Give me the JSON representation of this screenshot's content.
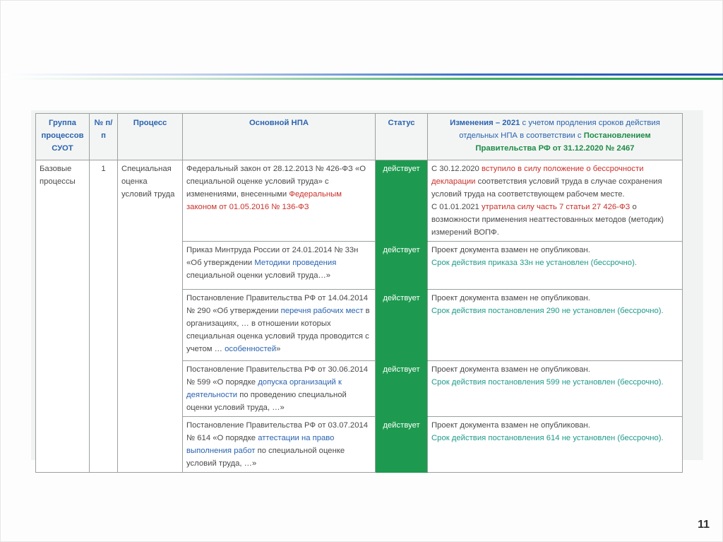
{
  "slide": {
    "page_number": "11"
  },
  "table": {
    "headers": {
      "group": "Группа процессов СУОТ",
      "num": "№ п/п",
      "process": "Процесс",
      "npa": "Основной НПА",
      "status": "Статус",
      "changes_part1": "Изменения – 2021",
      "changes_part2": " с учетом продления сроков действия отдельных НПА в соответствии с ",
      "changes_part3": "Постановлением Правительства РФ от 31.12.2020 № 2467"
    },
    "group_cell": "Базовые процессы",
    "num_cell": "1",
    "process_cell": "Специальная оценка условий труда",
    "rows": [
      {
        "npa_plain1": "Федеральный закон от 28.12.2013 № 426-ФЗ «О специальной оценке условий труда» с изменениями, внесенными ",
        "npa_link": "Федеральным законом от 01.05.2016 № 136-ФЗ",
        "status": "действует",
        "change_a": "С 30.12.2020 ",
        "change_b": "вступило в силу положение о бессрочности декларации",
        "change_c": " соответствия условий труда в случае сохранения условий труда на соответствующем рабочем месте.",
        "change_d": "С 01.01.2021 ",
        "change_e": "утратила силу часть 7 статьи 27 426-ФЗ",
        "change_f": " о возможности применения неаттестованных методов (методик) измерений ВОПФ."
      },
      {
        "npa_plain1": "Приказ Минтруда России от 24.01.2014 № 33н «Об утверждении ",
        "npa_link": "Методики проведения",
        "npa_plain2": " специальной оценки условий труда…»",
        "status": "действует",
        "change_plain": "Проект документа взамен не опубликован.",
        "change_term": "Срок действия приказа 33н не установлен (бессрочно)."
      },
      {
        "npa_plain1": "Постановление Правительства РФ от 14.04.2014 № 290 «Об утверждении ",
        "npa_link": "перечня рабочих мест",
        "npa_plain2": " в организациях, … в отношении которых специальная оценка условий труда проводится с учетом … ",
        "npa_link2": "особенностей",
        "npa_plain3": "»",
        "status": "действует",
        "change_plain": "Проект документа взамен не опубликован.",
        "change_term": "Срок действия постановления 290 не установлен (бессрочно)."
      },
      {
        "npa_plain1": "Постановление Правительства РФ от 30.06.2014 № 599 «О порядке ",
        "npa_link": "допуска организаций к деятельности",
        "npa_plain2": " по проведению специальной оценки условий труда, …»",
        "status": "действует",
        "change_plain": "Проект документа взамен не опубликован.",
        "change_term": "Срок действия постановления 599 не установлен (бессрочно)."
      },
      {
        "npa_plain1": "Постановление Правительства РФ от 03.07.2014 № 614 «О порядке ",
        "npa_link": "аттестации на право выполнения работ",
        "npa_plain2": " по специальной оценке условий труда, …»",
        "status": "действует",
        "change_plain": "Проект документа взамен не опубликован.",
        "change_term": "Срок действия постановления 614 не установлен (бессрочно)."
      }
    ]
  }
}
